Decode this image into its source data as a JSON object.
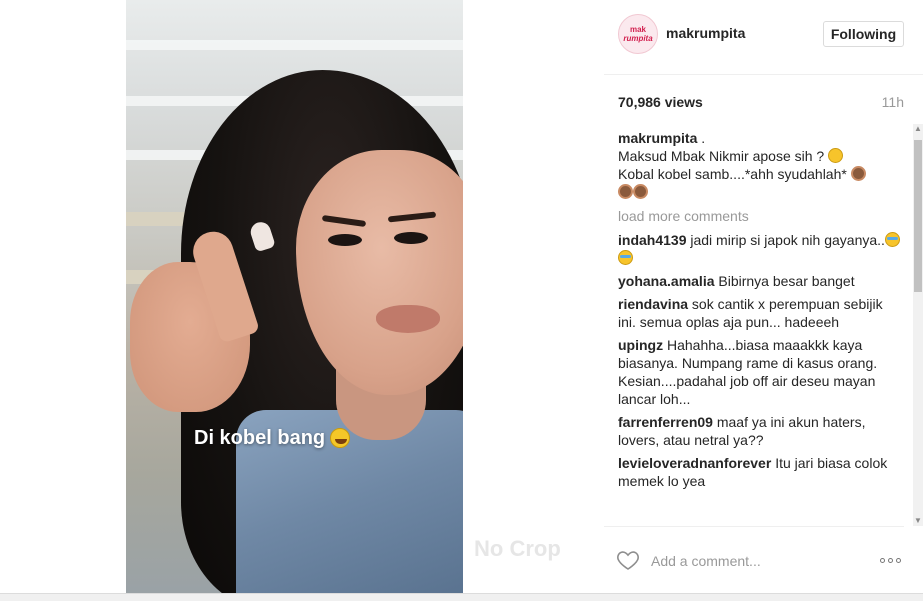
{
  "post": {
    "media": {
      "caption_text": "Di kobel bang",
      "caption_emoji": "tears-of-joy-emoji",
      "watermark": "No Crop"
    },
    "author": {
      "username": "makrumpita",
      "avatar_text_1": "mak",
      "avatar_text_2": "rumpita"
    },
    "follow_label": "Following",
    "views": "70,986 views",
    "time_ago": "11h",
    "caption": {
      "username": "makrumpita",
      "text_1": ".",
      "text_2": "Maksud Mbak Nikmir apose sih ?",
      "text_3": "Kobal kobel samb....*ahh syudahlah*"
    },
    "load_more": "load more comments",
    "comments": [
      {
        "username": "indah4139",
        "text": "jadi mirip si japok nih gayanya.."
      },
      {
        "username": "yohana.amalia",
        "text": "Bibirnya besar banget"
      },
      {
        "username": "riendavina",
        "text": "sok cantik x perempuan sebijik ini. semua oplas aja pun... hadeeeh"
      },
      {
        "username": "upingz",
        "text": "Hahahha...biasa maaakkk kaya biasanya. Numpang rame di kasus orang. Kesian....padahal job off air deseu mayan lancar loh..."
      },
      {
        "username": "farrenferren09",
        "text": "maaf ya ini akun haters, lovers, atau netral ya??"
      },
      {
        "username": "levieloveradnanforever",
        "text": "Itu jari biasa colok memek lo yea"
      }
    ],
    "add_comment_placeholder": "Add a comment...",
    "icons": {
      "like": "heart-icon",
      "more": "more-options-icon"
    },
    "colors": {
      "text": "#262626",
      "muted": "#999999",
      "border": "#dbdbdb"
    }
  }
}
